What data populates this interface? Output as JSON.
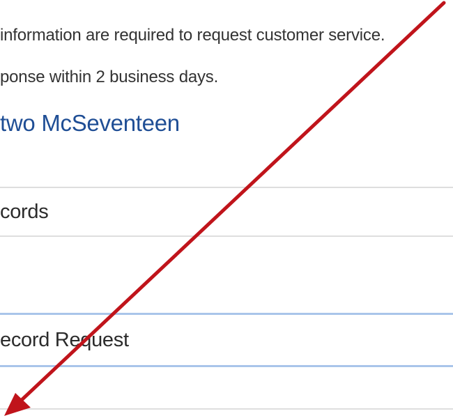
{
  "intro": {
    "line1": "information are required to request customer service.",
    "line2": "ponse within 2 business days."
  },
  "user": {
    "name": "two McSeventeen"
  },
  "form": {
    "category_value": "cords",
    "subject_value": "ecord Request"
  },
  "annotation": {
    "color": "#c0141b",
    "description": "red-arrow-pointing-down-left"
  }
}
